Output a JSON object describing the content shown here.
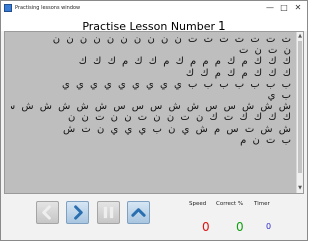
{
  "window": {
    "title": "Practising lessons window"
  },
  "lesson": {
    "title": "Practise Lesson Number",
    "number": "1"
  },
  "text_lines": [
    "ت ت ت ت ت ت ت ن ن ن ن ن ن ن ن ن ن",
    "ن ت ن ت",
    "ك ك ك م ك م م م ك م ك ك م ك ك ك",
    "ك ك ك م ك م ك ك",
    "ب ب ب ب ب ب ب ي ي ي ي ي ي ي ي ي",
    "ب ي",
    "ش ش ش س س ش ش س س س ش ش ش ش ش ش",
    "ك ك ك ك ت ك ن ت ن ن ت ن ن ت ن ن",
    "ش ش ت س م ش ي ن ب ي ي ي ن ت ش",
    "ب ت ن م"
  ],
  "controls": {
    "icons": {
      "back": "left-arrow-icon",
      "forward": "right-arrow-icon",
      "pause": "pause-icon",
      "up": "up-arrow-icon"
    },
    "enabled": {
      "back": false,
      "forward": true,
      "pause": false,
      "up": true
    }
  },
  "stats": {
    "speed_label": "Speed",
    "correct_label": "Correct %",
    "timer_label": "Timer",
    "speed_value": "0",
    "correct_value": "0",
    "timer_value": "0",
    "colors": {
      "speed": "#e01010",
      "correct": "#10a010",
      "timer": "#2a2ad0"
    }
  },
  "colors": {
    "text_area_bg": "#bebebe",
    "accent": "#2a6fb0"
  }
}
